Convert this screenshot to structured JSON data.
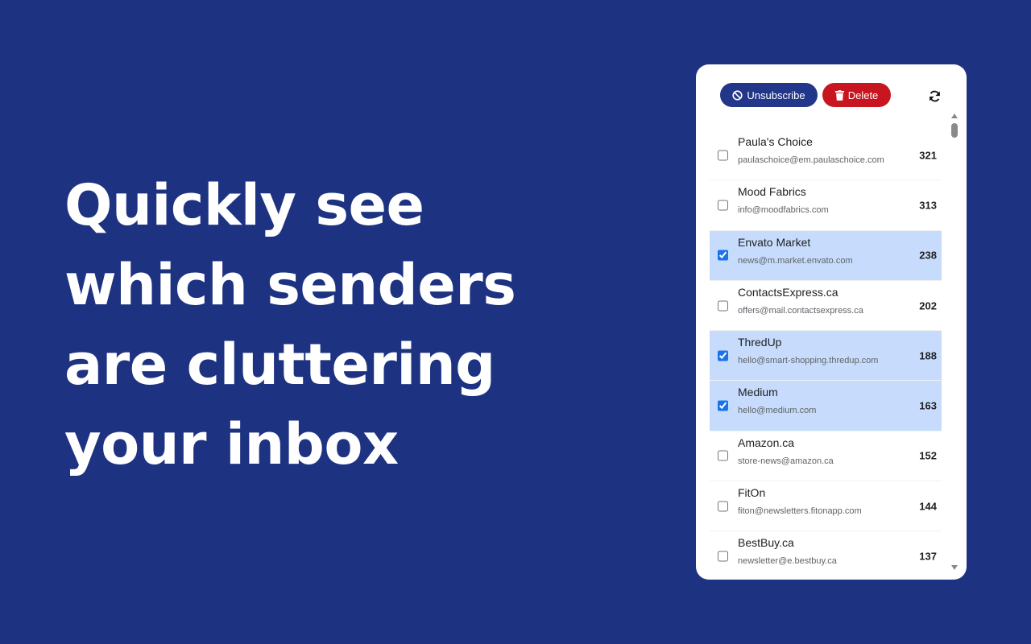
{
  "headline": "Quickly see which senders are cluttering your inbox",
  "toolbar": {
    "unsubscribe_label": "Unsubscribe",
    "delete_label": "Delete",
    "unsubscribe_color": "#22368a",
    "delete_color": "#c8151f",
    "refresh_icon": "refresh-icon"
  },
  "senders": [
    {
      "name": "Paula's Choice",
      "email": "paulaschoice@em.paulaschoice.com",
      "count": "321",
      "checked": false
    },
    {
      "name": "Mood Fabrics",
      "email": "info@moodfabrics.com",
      "count": "313",
      "checked": false
    },
    {
      "name": "Envato Market",
      "email": "news@m.market.envato.com",
      "count": "238",
      "checked": true
    },
    {
      "name": "ContactsExpress.ca",
      "email": "offers@mail.contactsexpress.ca",
      "count": "202",
      "checked": false
    },
    {
      "name": "ThredUp",
      "email": "hello@smart-shopping.thredup.com",
      "count": "188",
      "checked": true
    },
    {
      "name": "Medium",
      "email": "hello@medium.com",
      "count": "163",
      "checked": true
    },
    {
      "name": "Amazon.ca",
      "email": "store-news@amazon.ca",
      "count": "152",
      "checked": false
    },
    {
      "name": "FitOn",
      "email": "fiton@newsletters.fitonapp.com",
      "count": "144",
      "checked": false
    },
    {
      "name": "BestBuy.ca",
      "email": "newsletter@e.bestbuy.ca",
      "count": "137",
      "checked": false
    }
  ],
  "colors": {
    "background": "#1e3282",
    "selected_row": "#c7dcfc"
  }
}
